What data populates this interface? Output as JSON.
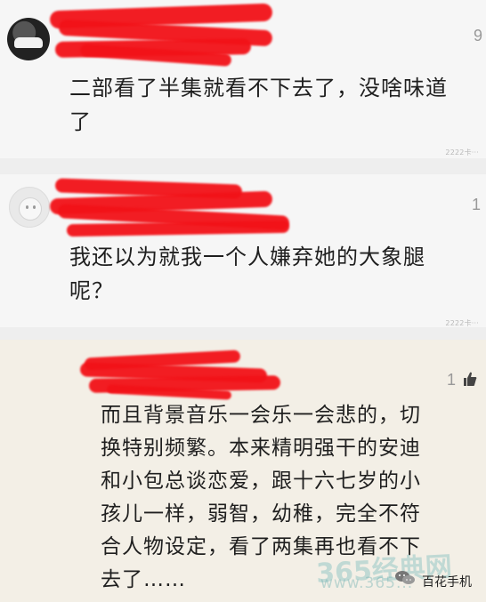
{
  "comments": [
    {
      "count": "9",
      "text": "二部看了半集就看不下去了，没啥味道\n了",
      "tiny": "2222卡···"
    },
    {
      "count": "1",
      "text": "我还以为就我一个人嫌弃她的大象腿\n呢？",
      "tiny": "2222卡···"
    },
    {
      "count": "1",
      "text": "而且背景音乐一会乐一会悲的，切\n换特别频繁。本来精明强干的安迪\n和小包总谈恋爱，跟十六七岁的小\n孩儿一样，弱智，幼稚，完全不符\n合人物设定，看了两集再也看不下\n去了……"
    }
  ],
  "watermark": {
    "site": "365经典网",
    "sub": "www.365...",
    "brand": "百花手机"
  },
  "icons": {
    "like": "thumbs-up-icon",
    "wechat": "wechat-icon"
  }
}
